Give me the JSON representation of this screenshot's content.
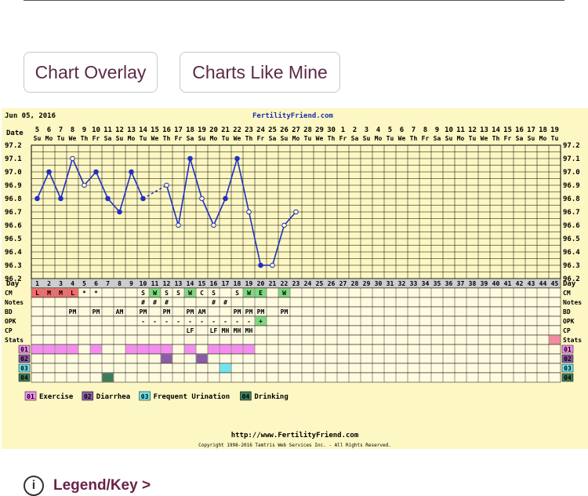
{
  "buttons": {
    "overlay": "Chart Overlay",
    "like_mine": "Charts Like Mine"
  },
  "header": {
    "date": "Jun 05, 2016",
    "site": "FertilityFriend.com"
  },
  "footer": {
    "url": "http://www.FertilityFriend.com",
    "copyright": "Copyright 1998-2016 Tamtris Web Services Inc. - All Rights Reserved."
  },
  "legend_link": "Legend/Key >",
  "row_labels": {
    "date": "Date",
    "day": "Day",
    "cm": "CM",
    "notes": "Notes",
    "bd": "BD",
    "opk": "OPK",
    "cp": "CP",
    "stats": "Stats",
    "custom": [
      "01",
      "02",
      "03",
      "04"
    ]
  },
  "custom_legend": [
    {
      "code": "01",
      "label": "Exercise",
      "color": "#f58cf0"
    },
    {
      "code": "02",
      "label": "Diarrhea",
      "color": "#8a5ca8"
    },
    {
      "code": "03",
      "label": "Frequent Urination",
      "color": "#6fe6ef"
    },
    {
      "code": "04",
      "label": "Drinking",
      "color": "#3f7a5a"
    }
  ],
  "dates": [
    "5",
    "6",
    "7",
    "8",
    "9",
    "10",
    "11",
    "12",
    "13",
    "14",
    "15",
    "16",
    "17",
    "18",
    "19",
    "20",
    "21",
    "22",
    "23",
    "24",
    "25",
    "26",
    "27",
    "28",
    "29",
    "30",
    "1",
    "2",
    "3",
    "4",
    "5",
    "6",
    "7",
    "8",
    "9",
    "10",
    "11",
    "12",
    "13",
    "14",
    "15",
    "16",
    "17",
    "18",
    "19"
  ],
  "weekdays": [
    "Su",
    "Mo",
    "Tu",
    "We",
    "Th",
    "Fr",
    "Sa",
    "Su",
    "Mo",
    "Tu",
    "We",
    "Th",
    "Fr",
    "Sa",
    "Su",
    "Mo",
    "Tu",
    "We",
    "Th",
    "Fr",
    "Sa",
    "Su",
    "Mo",
    "Tu",
    "We",
    "Th",
    "Fr",
    "Sa",
    "Su",
    "Mo",
    "Tu",
    "We",
    "Th",
    "Fr",
    "Sa",
    "Su",
    "Mo",
    "Tu",
    "We",
    "Th",
    "Fr",
    "Sa",
    "Su",
    "Mo",
    "Tu"
  ],
  "cm": [
    "L",
    "M",
    "M",
    "L",
    "*",
    "*",
    "",
    "",
    "",
    "S",
    "W",
    "S",
    "S",
    "W",
    "C",
    "S",
    "",
    "S",
    "W",
    "E",
    "",
    "W",
    "",
    "",
    "",
    "",
    "",
    "",
    "",
    "",
    "",
    "",
    "",
    "",
    "",
    "",
    "",
    "",
    "",
    "",
    "",
    "",
    "",
    "",
    ""
  ],
  "notes": [
    "",
    "",
    "",
    "",
    "",
    "",
    "",
    "",
    "",
    "#",
    "#",
    "#",
    "",
    "",
    "",
    "#",
    "#",
    "",
    "",
    "",
    "",
    "",
    "",
    "",
    "",
    "",
    "",
    "",
    "",
    "",
    "",
    "",
    "",
    "",
    "",
    "",
    "",
    "",
    "",
    "",
    "",
    "",
    "",
    "",
    ""
  ],
  "bd": [
    "",
    "",
    "",
    "PM",
    "",
    "PM",
    "",
    "AM",
    "",
    "PM",
    "",
    "PM",
    "",
    "PM",
    "AM",
    "",
    "",
    "PM",
    "PM",
    "PM",
    "",
    "PM",
    "",
    "",
    "",
    "",
    "",
    "",
    "",
    "",
    "",
    "",
    "",
    "",
    "",
    "",
    "",
    "",
    "",
    "",
    "",
    "",
    "",
    "",
    ""
  ],
  "opk": [
    "",
    "",
    "",
    "",
    "",
    "",
    "",
    "",
    "",
    "-",
    "-",
    "-",
    "-",
    "-",
    "-",
    "-",
    "-",
    "-",
    "-",
    "+",
    "",
    "",
    "",
    "",
    "",
    "",
    "",
    "",
    "",
    "",
    "",
    "",
    "",
    "",
    "",
    "",
    "",
    "",
    "",
    "",
    "",
    "",
    "",
    "",
    ""
  ],
  "cp": [
    "",
    "",
    "",
    "",
    "",
    "",
    "",
    "",
    "",
    "",
    "",
    "",
    "",
    "LF",
    "",
    "LF",
    "MH",
    "MH",
    "MH",
    "",
    "",
    "",
    "",
    "",
    "",
    "",
    "",
    "",
    "",
    "",
    "",
    "",
    "",
    "",
    "",
    "",
    "",
    "",
    "",
    "",
    "",
    "",
    "",
    "",
    ""
  ],
  "custom_marks": {
    "01": [
      1,
      2,
      3,
      4,
      6,
      9,
      10,
      11,
      12,
      14,
      16,
      17,
      18,
      19
    ],
    "02": [
      12,
      15
    ],
    "03": [
      17
    ],
    "04": [
      7
    ]
  },
  "chart_data": {
    "type": "line",
    "title": "",
    "xlabel": "Day",
    "ylabel": "",
    "ylim": [
      96.2,
      97.2
    ],
    "y_ticks": [
      "97.2",
      "97.1",
      "97.0",
      "96.9",
      "96.8",
      "96.7",
      "96.6",
      "96.5",
      "96.4",
      "96.3",
      "96.2"
    ],
    "x": [
      1,
      2,
      3,
      4,
      5,
      6,
      7,
      8,
      9,
      10,
      11,
      12,
      13,
      14,
      15,
      16,
      17,
      18,
      19,
      20,
      21,
      22,
      23
    ],
    "temps": [
      96.8,
      97.0,
      96.8,
      97.1,
      96.9,
      97.0,
      96.8,
      96.7,
      97.0,
      96.8,
      null,
      96.9,
      96.6,
      97.1,
      96.8,
      96.6,
      96.8,
      97.1,
      96.7,
      96.3,
      96.3,
      96.6,
      96.7
    ],
    "open_points": [
      4,
      5,
      12,
      13,
      15,
      16,
      19,
      21,
      22,
      23
    ],
    "dashed_segments": [
      [
        10,
        12
      ]
    ]
  }
}
